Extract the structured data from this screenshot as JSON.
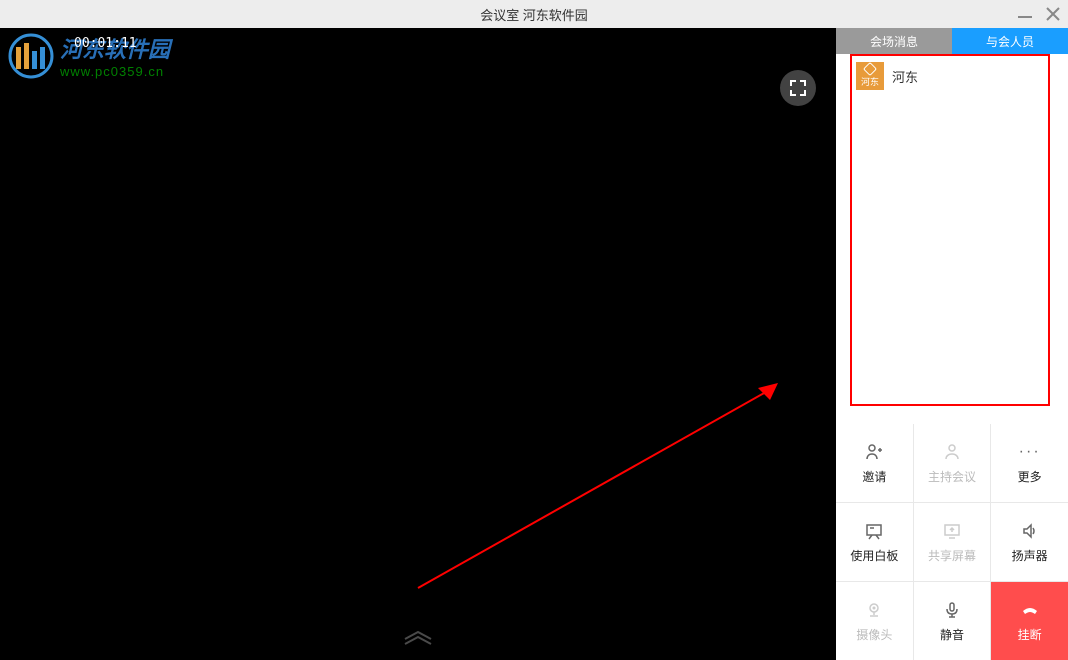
{
  "titlebar": {
    "title": "会议室  河东软件园"
  },
  "watermark": {
    "text_main": "河东软件园",
    "text_sub": "www.pc0359.cn"
  },
  "timer": "00:01:11",
  "tabs": {
    "messages": "会场消息",
    "participants": "与会人员"
  },
  "participant": {
    "avatar_label": "河东",
    "name": "河东"
  },
  "actions": {
    "invite": "邀请",
    "host": "主持会议",
    "more": "更多",
    "whiteboard": "使用白板",
    "share_screen": "共享屏幕",
    "speaker": "扬声器",
    "camera": "摄像头",
    "mute": "静音",
    "hangup": "挂断"
  }
}
